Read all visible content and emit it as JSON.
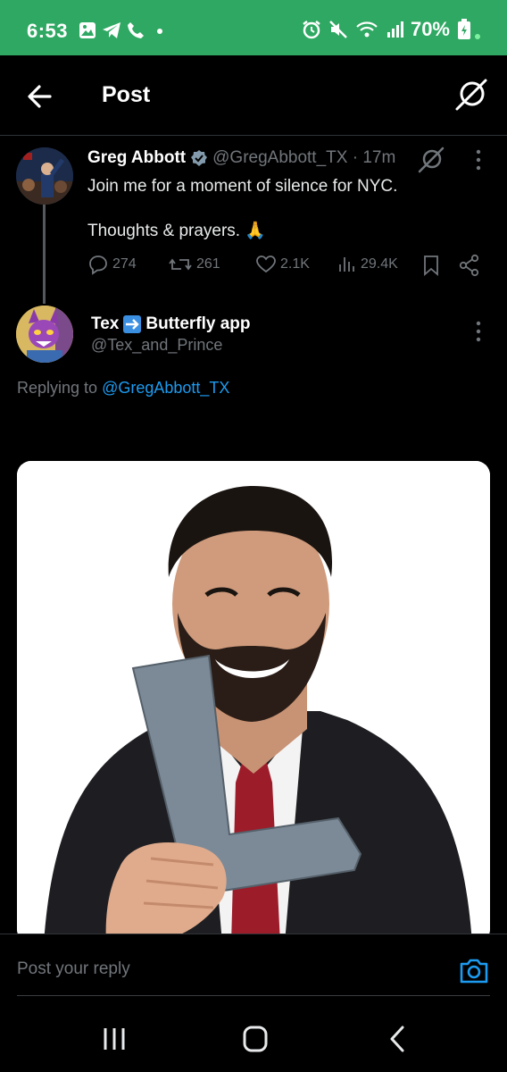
{
  "status_bar": {
    "time": "6:53",
    "battery": "70%",
    "left_icons": [
      "gallery-icon",
      "telegram-icon",
      "phone-icon",
      "dot-icon"
    ],
    "right_icons": [
      "alarm-icon",
      "mute-icon",
      "wifi-icon",
      "signal-icon",
      "battery-icon"
    ]
  },
  "header": {
    "title": "Post"
  },
  "original_post": {
    "author_name": "Greg Abbott",
    "handle_time": "@GregAbbott_TX · 17m",
    "text_line1": "Join me for a moment of silence for NYC.",
    "text_line2": "Thoughts & prayers. 🙏",
    "replies": "274",
    "reposts": "261",
    "likes": "2.1K",
    "views": "29.4K"
  },
  "reply": {
    "author_name_a": "Tex",
    "author_name_b": "Butterfly app",
    "handle": "@Tex_and_Prince",
    "replying_to_label": "Replying to",
    "replying_to_handle": "@GregAbbott_TX"
  },
  "composer": {
    "placeholder": "Post your reply"
  },
  "colors": {
    "status_bar": "#2ea862",
    "accent": "#1d9bf0",
    "muted_text": "#71767b",
    "background": "#000000"
  }
}
